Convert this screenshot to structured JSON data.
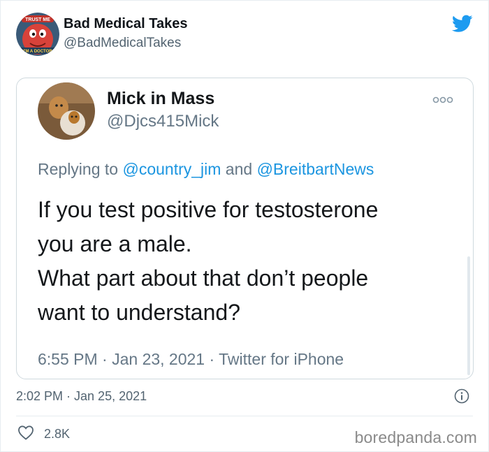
{
  "outer_tweet": {
    "display_name": "Bad Medical Takes",
    "handle": "@BadMedicalTakes",
    "avatar_badge": "TRUST ME",
    "avatar_caption": "I'M A DOCTOR",
    "timestamp": "2:02 PM · Jan 25, 2021",
    "like_count": "2.8K"
  },
  "quoted_tweet": {
    "display_name": "Mick in Mass",
    "handle": "@Djcs415Mick",
    "reply_prefix": "Replying to ",
    "reply_mention_1": "@country_jim",
    "reply_and": " and ",
    "reply_mention_2": "@BreitbartNews",
    "text_lines": [
      "If you test positive for testosterone",
      "you are a male.",
      "What part about that don’t people",
      "want to understand?"
    ],
    "meta": "6:55 PM · Jan 23, 2021 · Twitter for iPhone"
  },
  "watermark": "boredpanda.com",
  "colors": {
    "twitter_blue": "#1d9bf0",
    "mention_blue": "#1b95e0",
    "secondary_text": "#536471",
    "border": "#cfd9de"
  }
}
